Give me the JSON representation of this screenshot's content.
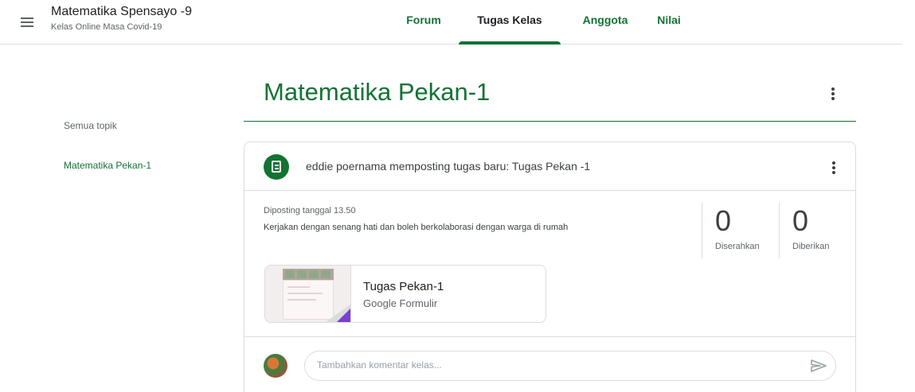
{
  "header": {
    "class_title": "Matematika Spensayo -9",
    "class_subtitle": "Kelas Online Masa Covid-19",
    "tabs": [
      {
        "label": "Forum"
      },
      {
        "label": "Tugas Kelas"
      },
      {
        "label": "Anggota"
      },
      {
        "label": "Nilai"
      }
    ],
    "active_tab": "Tugas Kelas"
  },
  "sidebar": {
    "topics": [
      {
        "label": "Semua topik"
      },
      {
        "label": "Matematika Pekan-1"
      }
    ]
  },
  "topic": {
    "heading": "Matematika Pekan-1"
  },
  "assignment": {
    "title": "eddie poernama memposting tugas baru: Tugas Pekan -1",
    "posted": "Diposting tanggal 13.50",
    "description": "Kerjakan dengan senang hati dan boleh berkolaborasi dengan warga di rumah",
    "stats": [
      {
        "value": "0",
        "label": "Diserahkan"
      },
      {
        "value": "0",
        "label": "Diberikan"
      }
    ],
    "attachment": {
      "title": "Tugas Pekan-1",
      "type": "Google Formulir"
    },
    "comment_placeholder": "Tambahkan komentar kelas..."
  },
  "colors": {
    "accent": "#137333",
    "border": "#dadce0",
    "form_purple": "#7b3fd0"
  },
  "icons": [
    "menu-icon",
    "more-vert-icon",
    "assignment-icon",
    "form-icon",
    "send-icon"
  ]
}
